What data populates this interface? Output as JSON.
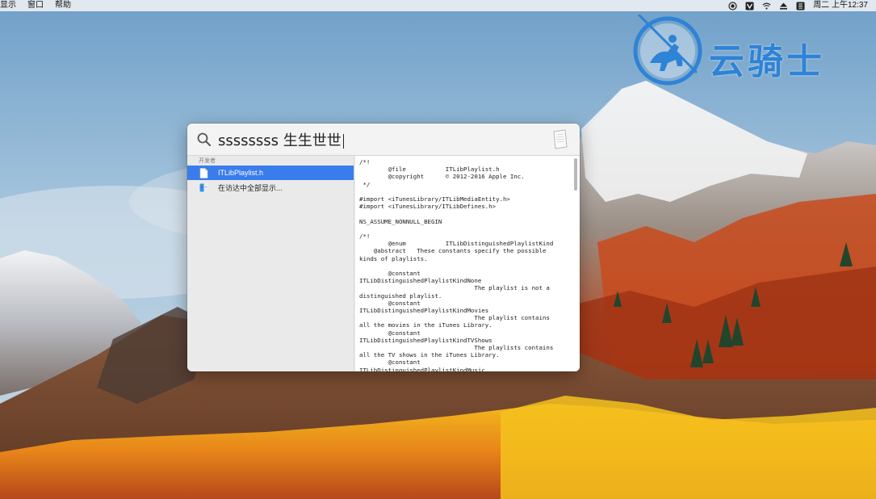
{
  "menubar": {
    "items": [
      "显示",
      "窗口",
      "帮助"
    ],
    "clock": "周二 上午12:37",
    "status_icons": [
      "record-icon",
      "notes-app-icon",
      "wifi-icon",
      "eject-icon",
      "input-method-icon"
    ]
  },
  "watermark": {
    "text": "云骑士"
  },
  "spotlight": {
    "query": "ssssssss 生生世世",
    "group_header": "开发者",
    "results": [
      {
        "label": "ITLibPlaylist.h",
        "icon": "header-file-icon",
        "selected": true
      },
      {
        "label": "在访达中全部显示...",
        "icon": "finder-icon",
        "selected": false
      }
    ],
    "preview_text": "/*!\n        @file           ITLibPlaylist.h\n        @copyright      © 2012-2016 Apple Inc.\n */\n\n#import <iTunesLibrary/ITLibMediaEntity.h>\n#import <iTunesLibrary/ITLibDefines.h>\n\nNS_ASSUME_NONNULL_BEGIN\n\n/*!\n        @enum           ITLibDistinguishedPlaylistKind\n    @abstract   These constants specify the possible\nkinds of playlists.\n\n        @constant\nITLibDistinguishedPlaylistKindNone\n                                The playlist is not a\ndistinguished playlist.\n        @constant\nITLibDistinguishedPlaylistKindMovies\n                                The playlist contains\nall the movies in the iTunes Library.\n        @constant\nITLibDistinguishedPlaylistKindTVShows\n                                The playlists contains\nall the TV shows in the iTunes Library.\n        @constant\nITLibDistinguishedPlaylistKindMusic"
  },
  "colors": {
    "selection": "#3a7cec",
    "watermark": "#2e83d6"
  }
}
